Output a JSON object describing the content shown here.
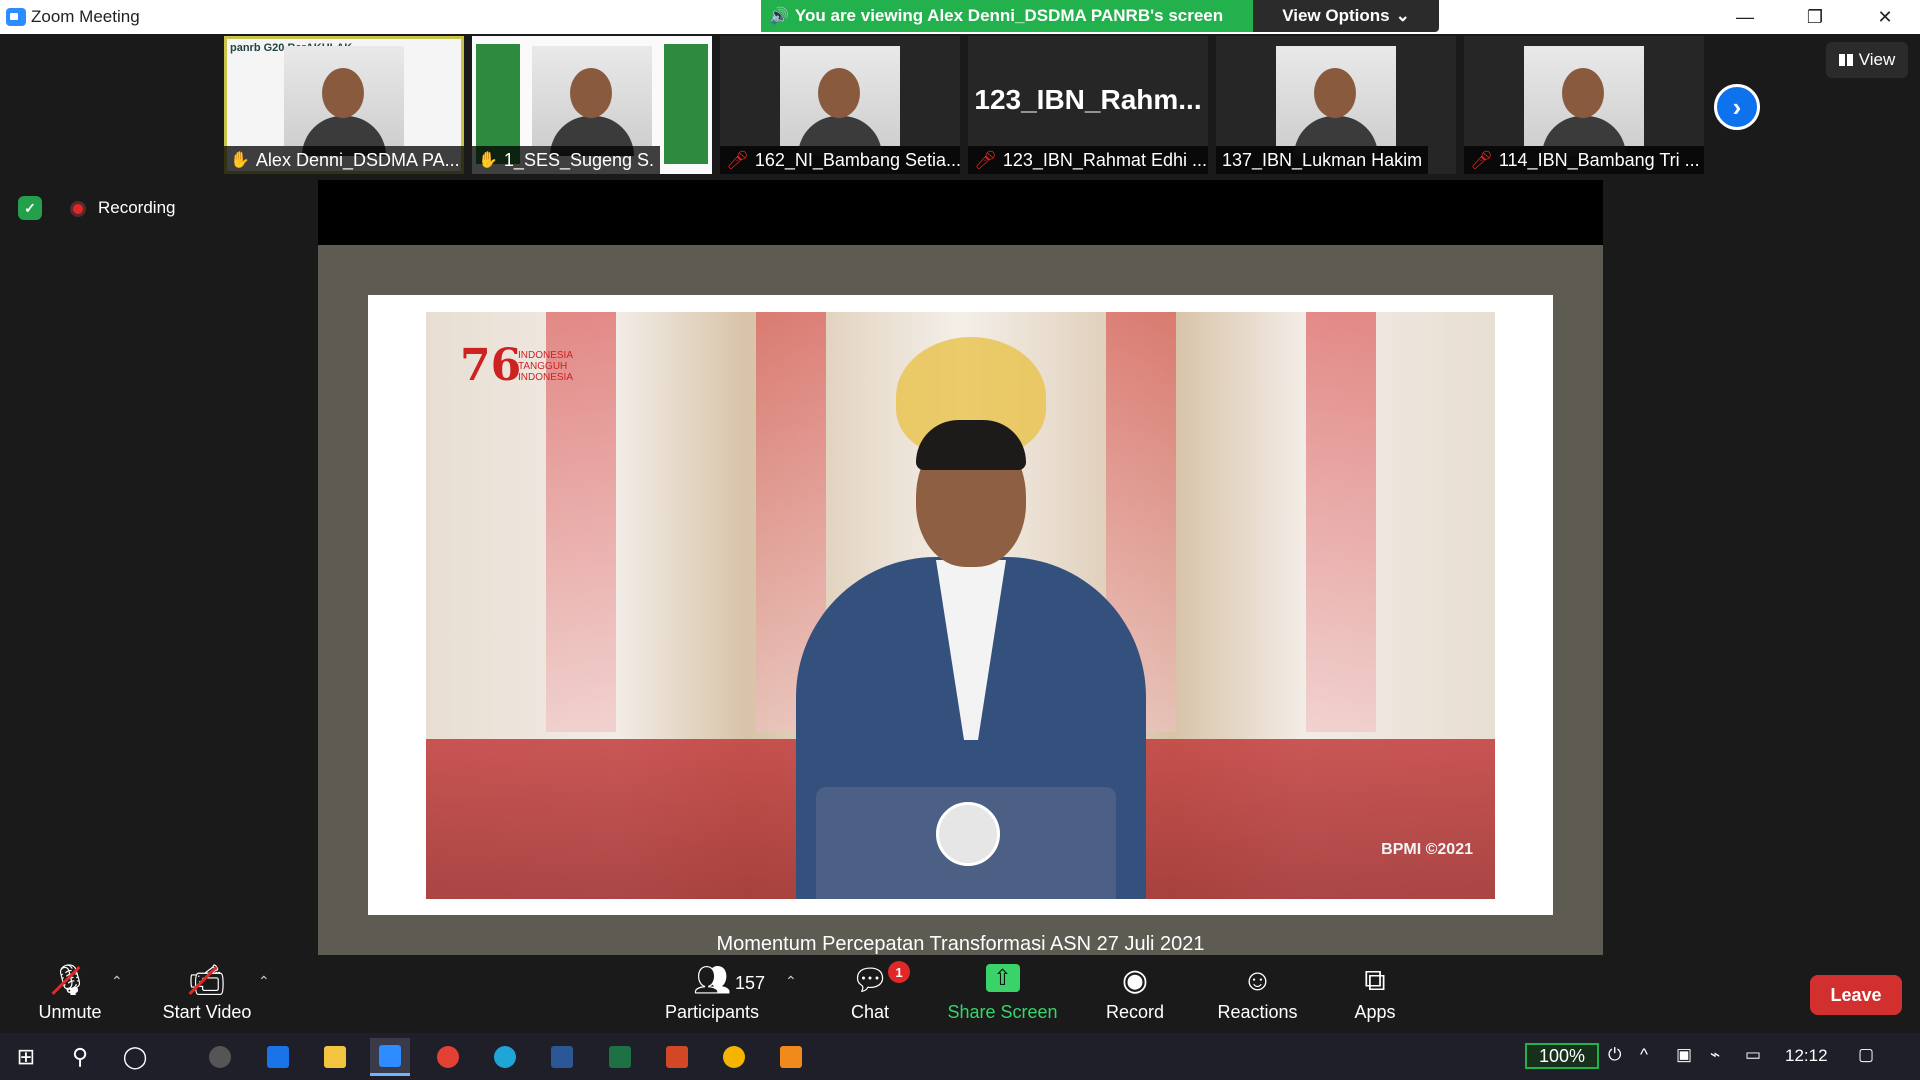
{
  "window": {
    "title": "Zoom Meeting",
    "minimize": "—",
    "restore": "❐",
    "close": "✕"
  },
  "banner": {
    "text": "You are viewing Alex Denni_DSDMA PANRB's screen",
    "view_options": "View Options",
    "color": "#23b14d"
  },
  "thumbnails": [
    {
      "name": "Alex Denni_DSDMA PA...",
      "icon": "hand-icon"
    },
    {
      "name": "1_SES_Sugeng S.",
      "icon": "hand-icon"
    },
    {
      "name": "162_NI_Bambang Setia...",
      "icon": "muted-mic-icon"
    },
    {
      "name": "123_IBN_Rahmat Edhi ...",
      "icon": "muted-mic-icon",
      "big_name": "123_IBN_Rahm..."
    },
    {
      "name": "137_IBN_Lukman Hakim",
      "icon": ""
    },
    {
      "name": "114_IBN_Bambang Tri ...",
      "icon": "muted-mic-icon"
    }
  ],
  "thumb1_banner": "panrb G20 BerAKHLAK",
  "view_button": "View",
  "recording": {
    "label": "Recording"
  },
  "shared_content": {
    "logo_number": "76",
    "logo_sub": "INDONESIA TANGGUH INDONESIA",
    "watermark": "BPMI ©2021",
    "caption": "Momentum Percepatan Transformasi ASN 27 Juli 2021"
  },
  "toolbar": {
    "unmute": "Unmute",
    "start_video": "Start Video",
    "participants": "Participants",
    "participant_count": "157",
    "chat": "Chat",
    "chat_badge": "1",
    "share_screen": "Share Screen",
    "record": "Record",
    "reactions": "Reactions",
    "apps": "Apps",
    "leave": "Leave"
  },
  "taskbar": {
    "zoom_level": "100%",
    "time": "12:12"
  }
}
